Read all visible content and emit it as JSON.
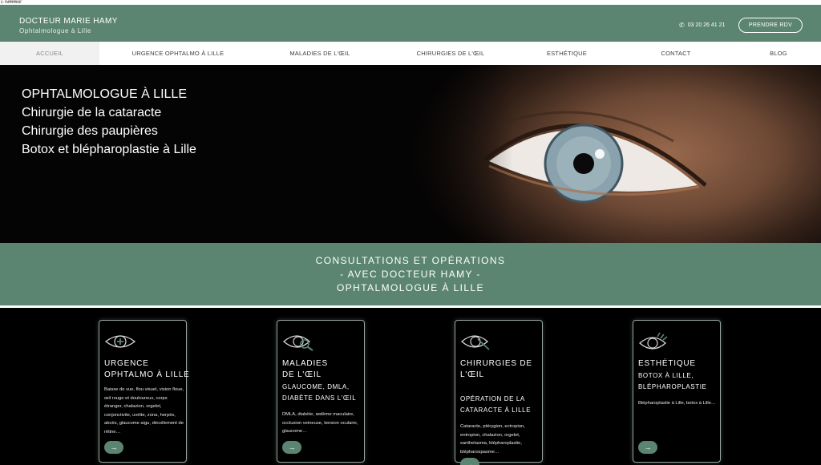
{
  "top_label": "Q-PWMMMMKNF",
  "header": {
    "name": "DOCTEUR MARIE HAMY",
    "subtitle": "Ophtalmologue à Lille",
    "phone": "03 20 26 41 21",
    "cta": "PRENDRE RDV"
  },
  "nav": {
    "items": [
      {
        "label": "ACCUEIL"
      },
      {
        "label": "URGENCE OPHTALMO À LILLE"
      },
      {
        "label": "MALADIES DE L'ŒIL"
      },
      {
        "label": "CHIRURGIES DE L'ŒIL"
      },
      {
        "label": "ESTHÉTIQUE"
      },
      {
        "label": "CONTACT"
      },
      {
        "label": "BLOG"
      }
    ]
  },
  "hero": {
    "lines": [
      "OPHTALMOLOGUE À LILLE",
      "Chirurgie de la cataracte",
      "Chirurgie des paupières",
      "Botox et blépharoplastie à Lille"
    ]
  },
  "banner": {
    "lines": [
      "CONSULTATIONS ET OPÉRATIONS",
      "- AVEC DOCTEUR HAMY -",
      "OPHTALMOLOGUE À LILLE"
    ]
  },
  "cards": [
    {
      "icon": "eye-cross-icon",
      "title": "URGENCE\nOPHTALMO À LILLE",
      "subtitle": "",
      "desc": "Baisse de vue, flou visuel, vision floue, œil rouge et douloureux, corps étranger, chalazion, orgelet, conjonctivite, uvéite, zona, herpès, abcès, glaucome aigu, décollement de rétine…"
    },
    {
      "icon": "eye-magnifier-icon",
      "title": "MALADIES\nDE L'ŒIL",
      "subtitle": "GLAUCOME, DMLA,\nDIABÈTE DANS L'ŒIL",
      "desc": "DMLA, diabète, œdème maculaire, occlusion veineuse, tension oculaire, glaucome…"
    },
    {
      "icon": "eye-scalpel-icon",
      "title": "CHIRURGIES DE\nL'ŒIL",
      "subtitle": "OPÉRATION DE LA\nCATARACTE À LILLE",
      "desc": "Cataracte, ptérygion, ectropion, entropion, chalazion, orgelet, xanthelasma, blépharoplastie, blépharospasme…"
    },
    {
      "icon": "eye-lashes-icon",
      "title": "ESTHÉTIQUE",
      "subtitle": "BOTOX À LILLE,\nBLÉPHAROPLASTIE",
      "desc": "Blépharoplastie à Lille, botox à Lille…"
    }
  ],
  "arrow": "→",
  "colors": {
    "accent": "#5b8571",
    "dark": "#000000"
  }
}
